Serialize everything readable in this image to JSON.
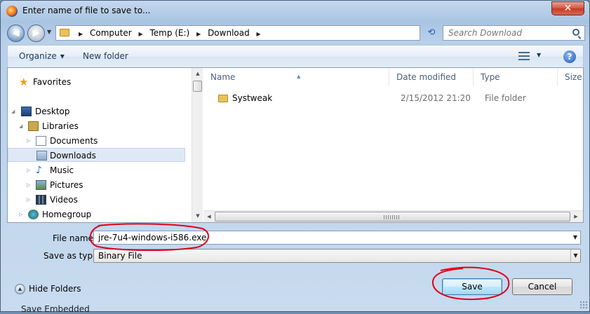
{
  "window": {
    "title": "Enter name of file to save to...",
    "close_label": "✕"
  },
  "address": {
    "crumbs": [
      "Computer",
      "Temp (E:)",
      "Download"
    ],
    "search_placeholder": "Search Download"
  },
  "toolbar": {
    "organize_label": "Organize",
    "new_folder_label": "New folder",
    "help_label": "?"
  },
  "nav_pane": {
    "items": [
      {
        "label": "Favorites",
        "icon": "star-icon"
      },
      {
        "label": "Desktop",
        "icon": "desktop-icon"
      },
      {
        "label": "Libraries",
        "icon": "libraries-icon"
      },
      {
        "label": "Documents",
        "icon": "documents-icon"
      },
      {
        "label": "Downloads",
        "icon": "downloads-icon",
        "selected": true
      },
      {
        "label": "Music",
        "icon": "music-icon"
      },
      {
        "label": "Pictures",
        "icon": "pictures-icon"
      },
      {
        "label": "Videos",
        "icon": "videos-icon"
      },
      {
        "label": "Homegroup",
        "icon": "homegroup-icon"
      }
    ]
  },
  "file_list": {
    "columns": [
      "Name",
      "Date modified",
      "Type",
      "Size"
    ],
    "rows": [
      {
        "name": "Systweak",
        "date": "2/15/2012 21:20",
        "type": "File folder",
        "size": ""
      }
    ]
  },
  "form": {
    "file_name_label": "File name:",
    "file_name_value": "jre-7u4-windows-i586.exe",
    "save_type_label": "Save as type:",
    "save_type_value": "Binary File"
  },
  "footer": {
    "hide_folders_label": "Hide Folders",
    "save_label": "Save",
    "cancel_label": "Cancel"
  },
  "background": {
    "sliver_text": "Save Embedded"
  },
  "colors": {
    "annotation_red": "#e0001b",
    "accent_blue": "#1d58b5"
  }
}
